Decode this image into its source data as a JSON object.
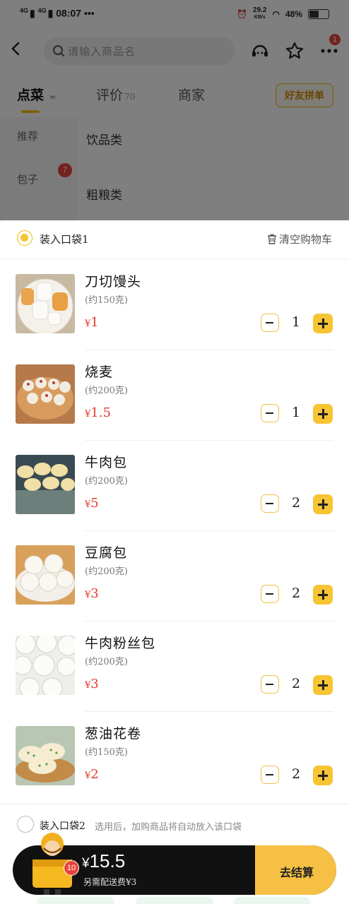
{
  "status_bar": {
    "signal1": "4G",
    "signal2": "4G",
    "time": "08:07",
    "dots": "•••",
    "speed": "29.2",
    "speed_unit": "KB/s",
    "battery": "48%"
  },
  "header": {
    "search_placeholder": "请输入商品名",
    "more_badge": "1"
  },
  "tabs": [
    {
      "label": "点菜",
      "count": ""
    },
    {
      "label": "评价",
      "count": "70"
    },
    {
      "label": "商家",
      "count": ""
    }
  ],
  "group_order_label": "好友拼单",
  "sidebar": {
    "items": [
      {
        "label": "推荐"
      },
      {
        "label": "包子",
        "badge": "7"
      }
    ]
  },
  "categories": [
    "饮品类",
    "粗粮类"
  ],
  "cart": {
    "bag1_label": "装入口袋1",
    "clear_label": "清空购物车",
    "items": [
      {
        "name": "刀切馒头",
        "weight": "(约150克)",
        "currency": "¥",
        "price": "1",
        "qty": "1"
      },
      {
        "name": "烧麦",
        "weight": "(约200克)",
        "currency": "¥",
        "price": "1.5",
        "qty": "1"
      },
      {
        "name": "牛肉包",
        "weight": "(约200克)",
        "currency": "¥",
        "price": "5",
        "qty": "2"
      },
      {
        "name": "豆腐包",
        "weight": "(约200克)",
        "currency": "¥",
        "price": "3",
        "qty": "2"
      },
      {
        "name": "牛肉粉丝包",
        "weight": "(约200克)",
        "currency": "¥",
        "price": "3",
        "qty": "2"
      },
      {
        "name": "葱油花卷",
        "weight": "(约150克)",
        "currency": "¥",
        "price": "2",
        "qty": "2"
      }
    ],
    "bag2_label": "装入口袋2",
    "bag2_hint": "选用后，加购商品将自动放入该口袋"
  },
  "checkout": {
    "currency": "¥",
    "total": "15.5",
    "delivery_fee": "另需配送费¥3",
    "cart_count": "10",
    "pay_label": "去结算"
  },
  "colors": {
    "accent": "#f7c433",
    "price": "#e4392c",
    "badge": "#e8453c"
  }
}
